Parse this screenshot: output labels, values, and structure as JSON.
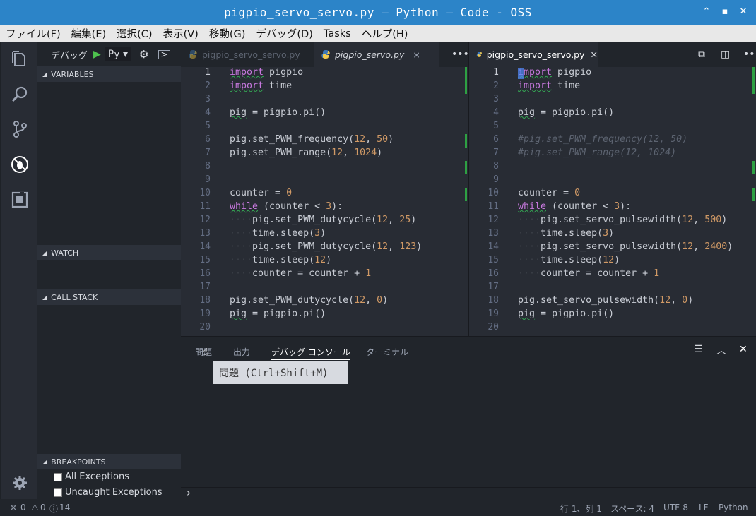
{
  "window": {
    "title": "pigpio_servo_servo.py — Python — Code - OSS",
    "controls": [
      "⌃",
      "▪",
      "✕"
    ]
  },
  "menu": [
    "ファイル(F)",
    "編集(E)",
    "選択(C)",
    "表示(V)",
    "移動(G)",
    "デバッグ(D)",
    "Tasks",
    "ヘルプ(H)"
  ],
  "activity_icons": [
    "files-icon",
    "search-icon",
    "source-control-icon",
    "debug-icon",
    "extensions-icon",
    "settings-gear-icon"
  ],
  "debug": {
    "label": "デバッグ",
    "config": "Py",
    "sections": {
      "variables": "VARIABLES",
      "watch": "WATCH",
      "call_stack": "CALL STACK",
      "breakpoints": "BREAKPOINTS"
    },
    "breakpoints": [
      "All Exceptions",
      "Uncaught Exceptions"
    ]
  },
  "left_editor": {
    "tabs": [
      {
        "label": "pigpio_servo_servo.py",
        "active": false
      },
      {
        "label": "pigpio_servo.py",
        "active": true,
        "close": "×"
      }
    ],
    "lines": [
      [
        [
          "kw sq",
          "import"
        ],
        [
          "",
          " pigpio"
        ]
      ],
      [
        [
          "kw sq",
          "import"
        ],
        [
          "",
          " time"
        ]
      ],
      [],
      [
        [
          "sq",
          "pig"
        ],
        [
          "",
          " = pigpio.pi()"
        ]
      ],
      [],
      [
        [
          "",
          "pig.set_PWM_frequency("
        ],
        [
          "num",
          "12"
        ],
        [
          "",
          ", "
        ],
        [
          "num",
          "50"
        ],
        [
          "",
          ")"
        ]
      ],
      [
        [
          "",
          "pig.set_PWM_range("
        ],
        [
          "num",
          "12"
        ],
        [
          "",
          ", "
        ],
        [
          "num",
          "1024"
        ],
        [
          "",
          ")"
        ]
      ],
      [],
      [],
      [
        [
          "",
          "counter = "
        ],
        [
          "num",
          "0"
        ]
      ],
      [
        [
          "kw sq",
          "while"
        ],
        [
          "",
          " (counter < "
        ],
        [
          "num",
          "3"
        ],
        [
          "",
          "):"
        ]
      ],
      [
        [
          "ws",
          "····"
        ],
        [
          "",
          "pig.set_PWM_dutycycle("
        ],
        [
          "num",
          "12"
        ],
        [
          "",
          ", "
        ],
        [
          "num",
          "25"
        ],
        [
          "",
          ")"
        ]
      ],
      [
        [
          "ws",
          "····"
        ],
        [
          "",
          "time.sleep("
        ],
        [
          "num",
          "3"
        ],
        [
          "",
          ")"
        ]
      ],
      [
        [
          "ws",
          "····"
        ],
        [
          "",
          "pig.set_PWM_dutycycle("
        ],
        [
          "num",
          "12"
        ],
        [
          "",
          ", "
        ],
        [
          "num",
          "123"
        ],
        [
          "",
          ")"
        ]
      ],
      [
        [
          "ws",
          "····"
        ],
        [
          "",
          "time.sleep("
        ],
        [
          "num",
          "12"
        ],
        [
          "",
          ")"
        ]
      ],
      [
        [
          "ws",
          "····"
        ],
        [
          "",
          "counter = counter + "
        ],
        [
          "num",
          "1"
        ]
      ],
      [],
      [
        [
          "",
          "pig.set_PWM_dutycycle("
        ],
        [
          "num",
          "12"
        ],
        [
          "",
          ", "
        ],
        [
          "num",
          "0"
        ],
        [
          "",
          ")"
        ]
      ],
      [
        [
          "sq",
          "pig"
        ],
        [
          "",
          " = pigpio.pi()"
        ]
      ],
      []
    ]
  },
  "right_editor": {
    "tabs": [
      {
        "label": "pigpio_servo_servo.py",
        "active": true,
        "close": "✕"
      }
    ],
    "lines": [
      [
        [
          "kw sq",
          "import"
        ],
        [
          "",
          " pigpio"
        ]
      ],
      [
        [
          "kw sq",
          "import"
        ],
        [
          "",
          " time"
        ]
      ],
      [],
      [
        [
          "sq",
          "pig"
        ],
        [
          "",
          " = pigpio.pi()"
        ]
      ],
      [],
      [
        [
          "cmt",
          "#pig.set_PWM_frequency(12, 50)"
        ]
      ],
      [
        [
          "cmt",
          "#pig.set_PWM_range(12, 1024)"
        ]
      ],
      [],
      [],
      [
        [
          "",
          "counter = "
        ],
        [
          "num",
          "0"
        ]
      ],
      [
        [
          "kw sq",
          "while"
        ],
        [
          "",
          " (counter < "
        ],
        [
          "num",
          "3"
        ],
        [
          "",
          "):"
        ]
      ],
      [
        [
          "ws",
          "····"
        ],
        [
          "",
          "pig.set_servo_pulsewidth("
        ],
        [
          "num",
          "12"
        ],
        [
          "",
          ", "
        ],
        [
          "num",
          "500"
        ],
        [
          "",
          ")"
        ]
      ],
      [
        [
          "ws",
          "····"
        ],
        [
          "",
          "time.sleep("
        ],
        [
          "num",
          "3"
        ],
        [
          "",
          ")"
        ]
      ],
      [
        [
          "ws",
          "····"
        ],
        [
          "",
          "pig.set_servo_pulsewidth("
        ],
        [
          "num",
          "12"
        ],
        [
          "",
          ", "
        ],
        [
          "num",
          "2400"
        ],
        [
          "",
          ")"
        ]
      ],
      [
        [
          "ws",
          "····"
        ],
        [
          "",
          "time.sleep("
        ],
        [
          "num",
          "12"
        ],
        [
          "",
          ")"
        ]
      ],
      [
        [
          "ws",
          "····"
        ],
        [
          "",
          "counter = counter + "
        ],
        [
          "num",
          "1"
        ]
      ],
      [],
      [
        [
          "",
          "pig.set_servo_pulsewidth("
        ],
        [
          "num",
          "12"
        ],
        [
          "",
          ", "
        ],
        [
          "num",
          "0"
        ],
        [
          "",
          ")"
        ]
      ],
      [
        [
          "sq",
          "pig"
        ],
        [
          "",
          " = pigpio.pi()"
        ]
      ],
      []
    ]
  },
  "panel": {
    "tabs": [
      "問題",
      "出力",
      "デバッグ コンソール",
      "ターミナル"
    ],
    "active_tab": "デバッグ コンソール",
    "tooltip": "問題 (Ctrl+Shift+M)",
    "prompt": "›"
  },
  "status": {
    "errors": "0",
    "warnings": "0",
    "infos": "14",
    "position": "行 1、列 1",
    "spaces": "スペース: 4",
    "encoding": "UTF-8",
    "eol": "LF",
    "language": "Python"
  },
  "colors": {
    "title_bar": "#2c84c8",
    "keyword": "#c678dd",
    "number": "#d19a66",
    "comment": "#5c6370",
    "debug_play": "#4ec14e",
    "gutter_added": "#2ea043"
  }
}
